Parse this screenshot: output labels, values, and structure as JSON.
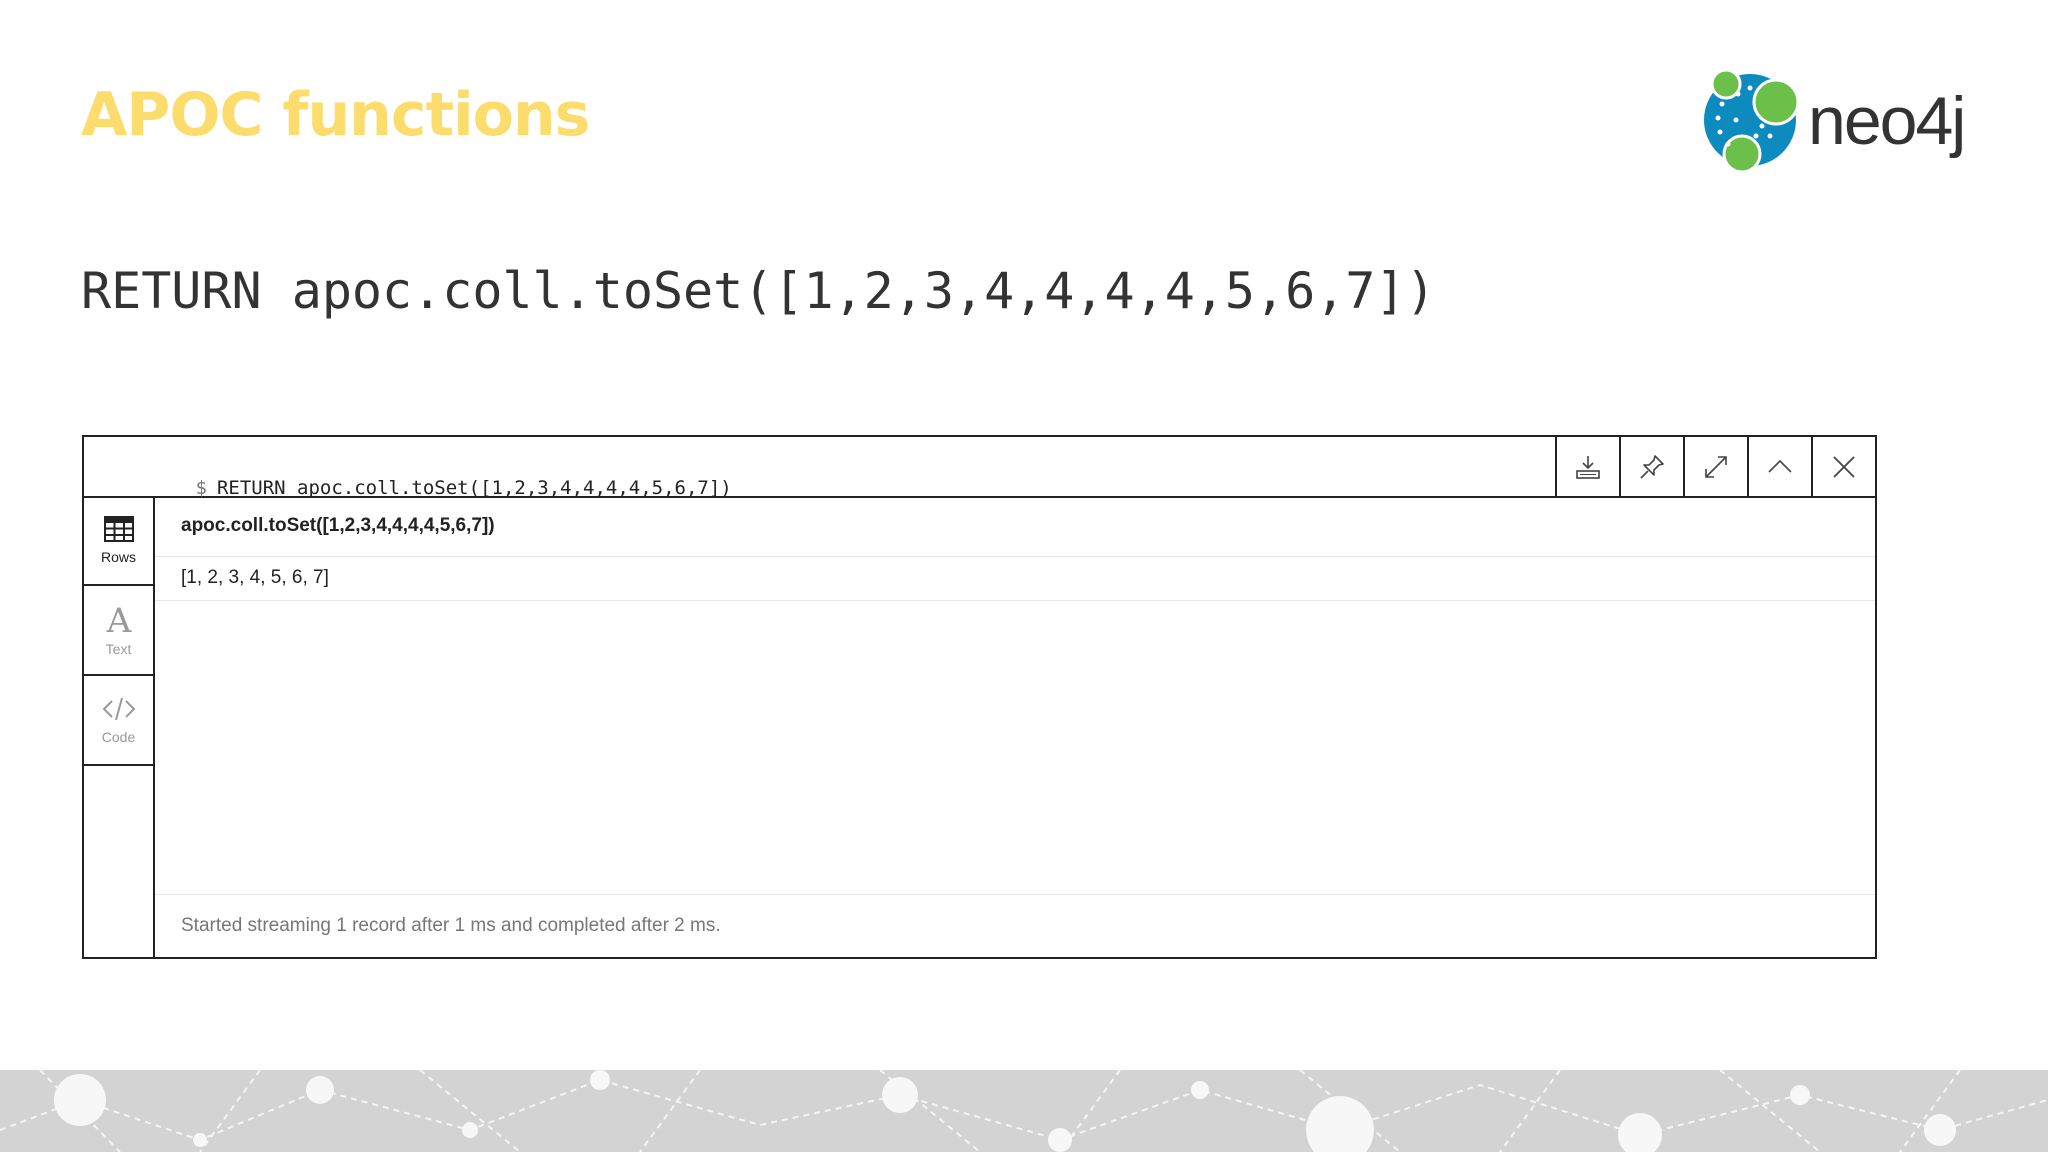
{
  "slide": {
    "title": "APOC functions",
    "query": "RETURN apoc.coll.toSet([1,2,3,4,4,4,4,5,6,7])",
    "logo_text": "neo4j"
  },
  "frame": {
    "prompt": "$",
    "command": "RETURN apoc.coll.toSet([1,2,3,4,4,4,4,5,6,7])",
    "buttons": [
      "download-icon",
      "pin-icon",
      "expand-icon",
      "collapse-icon",
      "close-icon"
    ],
    "tabs": [
      {
        "label": "Rows",
        "icon": "table-icon",
        "active": true
      },
      {
        "label": "Text",
        "icon": "text-icon",
        "active": false
      },
      {
        "label": "Code",
        "icon": "code-icon",
        "active": false
      }
    ],
    "column_header": "apoc.coll.toSet([1,2,3,4,4,4,4,5,6,7])",
    "row_value": "[1, 2, 3, 4, 5, 6, 7]",
    "status": "Started streaming 1 record after 1 ms and completed after 2 ms."
  },
  "colors": {
    "title": "#fbdc6d",
    "logo_blue": "#0d8bbf",
    "logo_green": "#6cc04a",
    "border": "#222222"
  }
}
